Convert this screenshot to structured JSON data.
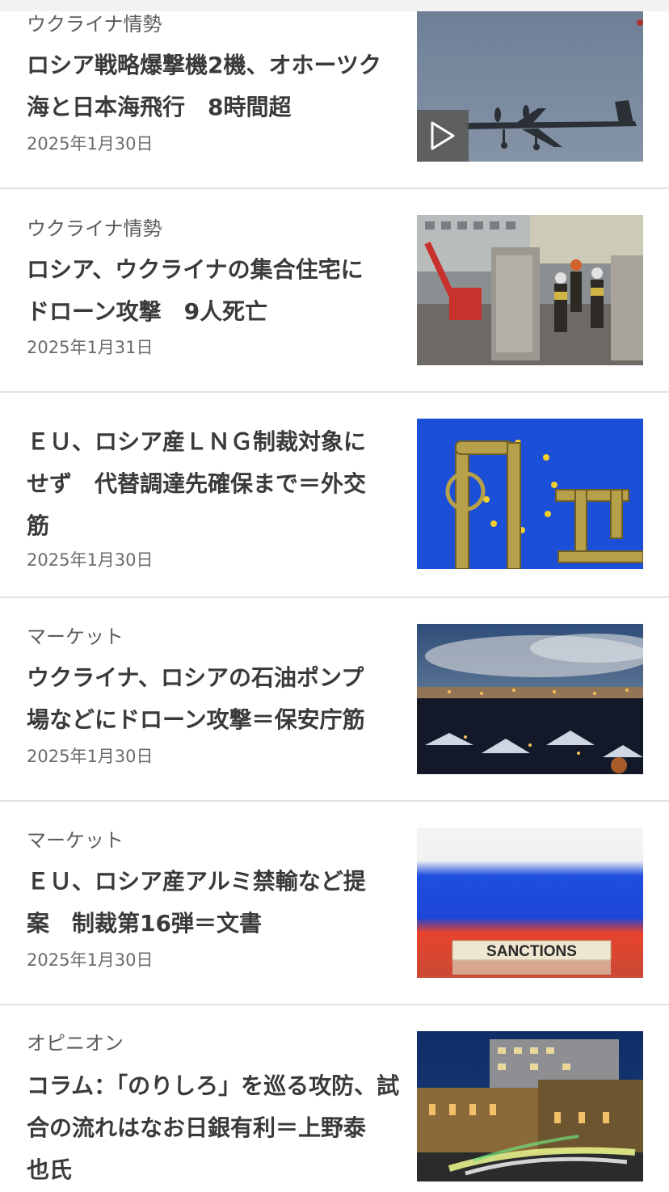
{
  "articles": [
    {
      "category": "ウクライナ情勢",
      "title_lines": [
        "ロシア戦略爆撃機2機、オホーツク",
        "海と日本海飛行　8時間超"
      ],
      "date": "2025年1月30日",
      "thumb_icon": "bomber-plane-photo",
      "has_video": true
    },
    {
      "category": "ウクライナ情勢",
      "title_lines": [
        "ロシア、ウクライナの集合住宅に",
        "ドローン攻撃　9人死亡"
      ],
      "date": "2025年1月31日",
      "thumb_icon": "rescue-workers-rubble-photo",
      "has_video": false
    },
    {
      "category": "",
      "title_lines": [
        "ＥＵ、ロシア産ＬＮＧ制裁対象に",
        "せず　代替調達先確保まで＝外交",
        "筋"
      ],
      "date": "2025年1月30日",
      "thumb_icon": "gas-pipes-eu-flag-photo",
      "has_video": false
    },
    {
      "category": "マーケット",
      "title_lines": [
        "ウクライナ、ロシアの石油ポンプ",
        "場などにドローン攻撃＝保安庁筋"
      ],
      "date": "2025年1月30日",
      "thumb_icon": "industrial-night-city-photo",
      "has_video": false
    },
    {
      "category": "マーケット",
      "title_lines": [
        "ＥＵ、ロシア産アルミ禁輸など提",
        "案　制裁第16弾＝文書"
      ],
      "date": "2025年1月30日",
      "thumb_icon": "sanctions-blocks-flag-photo",
      "thumb_text": "SANCTIONS",
      "has_video": false
    },
    {
      "category": "オピニオン",
      "title_lines": [
        "コラム：「のりしろ」を巡る攻防、試",
        "合の流れはなお日銀有利＝上野泰",
        "也氏"
      ],
      "date": "",
      "thumb_icon": "boj-building-night-photo",
      "has_video": false
    }
  ],
  "play_icon": "play-icon",
  "colors": {
    "title": "#3a3a3a",
    "category": "#5c5c5c",
    "date": "#6b6b6b",
    "divider": "#e2e2e2"
  }
}
